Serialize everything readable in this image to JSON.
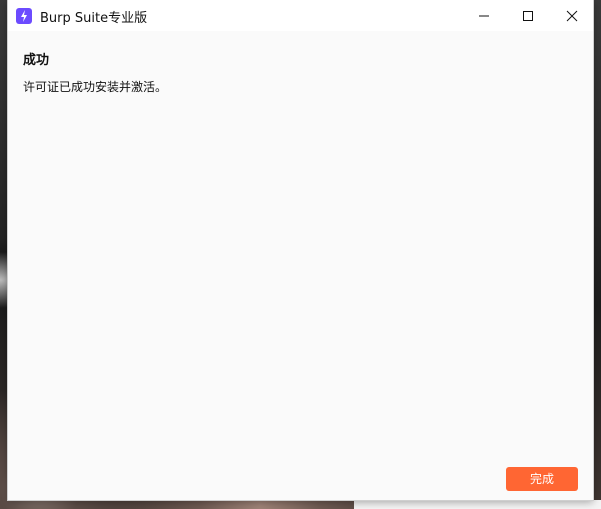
{
  "window": {
    "title": "Burp Suite专业版",
    "app_icon": "burp-lightning-icon",
    "controls": {
      "minimize": "minimize-icon",
      "maximize": "maximize-icon",
      "close": "close-icon"
    }
  },
  "content": {
    "heading": "成功",
    "message": "许可证已成功安装并激活。",
    "finish_label": "完成"
  },
  "colors": {
    "accent": "#ff6633",
    "app_icon": "#6c4bff",
    "background": "#fafafa"
  }
}
